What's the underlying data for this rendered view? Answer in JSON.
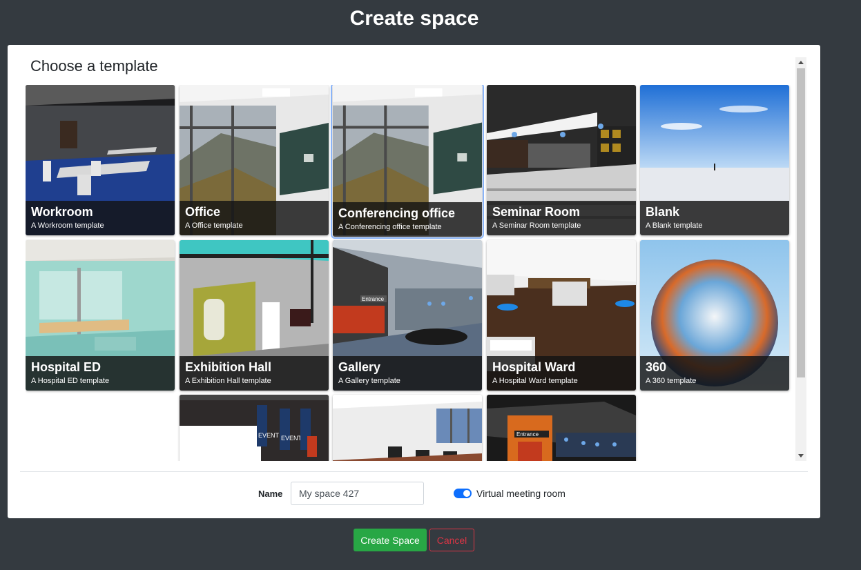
{
  "page": {
    "title": "Create space"
  },
  "modal": {
    "section_title": "Choose a template"
  },
  "templates": [
    {
      "title": "Workroom",
      "subtitle": "A Workroom template"
    },
    {
      "title": "Office",
      "subtitle": "A Office template"
    },
    {
      "title": "Conferencing office",
      "subtitle": "A Conferencing office template"
    },
    {
      "title": "Seminar Room",
      "subtitle": "A Seminar Room template"
    },
    {
      "title": "Blank",
      "subtitle": "A Blank template"
    },
    {
      "title": "Hospital ED",
      "subtitle": "A Hospital ED template"
    },
    {
      "title": "Exhibition Hall",
      "subtitle": "A Exhibition Hall template"
    },
    {
      "title": "Gallery",
      "subtitle": "A Gallery template"
    },
    {
      "title": "Hospital Ward",
      "subtitle": "A Hospital Ward template"
    },
    {
      "title": "360",
      "subtitle": "A 360 template"
    }
  ],
  "thumb_texts": {
    "entrance": "Entrance",
    "event": "EVENT"
  },
  "form": {
    "name_label": "Name",
    "name_value": "My space 427",
    "toggle_label": "Virtual meeting room",
    "toggle_on": true
  },
  "buttons": {
    "create": "Create Space",
    "cancel": "Cancel"
  },
  "colors": {
    "background": "#343a40",
    "primary": "#0d6efd",
    "success": "#28a745",
    "danger": "#dc3545"
  }
}
